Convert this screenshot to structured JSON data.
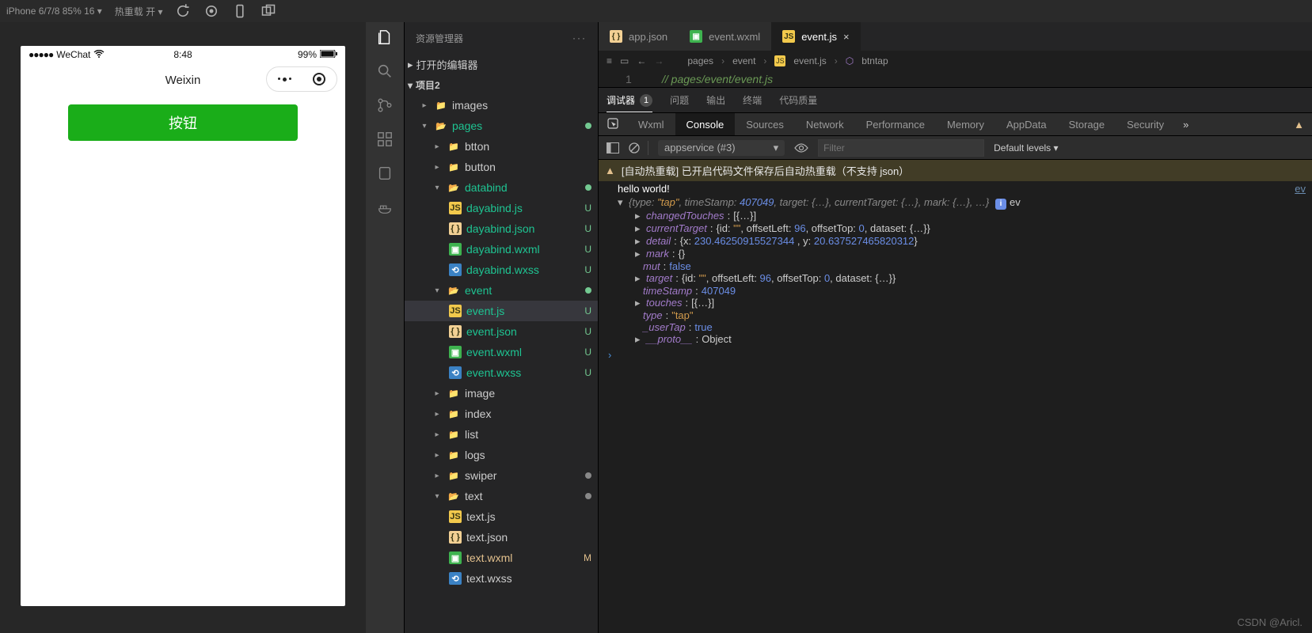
{
  "titlebar": {
    "device": "iPhone 6/7/8 85% 16 ▾",
    "reload_label": "热重载 开 ▾"
  },
  "phone": {
    "carrier": "WeChat",
    "time": "8:48",
    "battery": "99%",
    "nav_title": "Weixin",
    "button_label": "按钮"
  },
  "explorer": {
    "title": "资源管理器",
    "sec_editors": "打开的编辑器",
    "project": "项目2",
    "nodes": {
      "images": "images",
      "pages": "pages",
      "btton": "btton",
      "button": "button",
      "databind": "databind",
      "dayabind_js": "dayabind.js",
      "dayabind_json": "dayabind.json",
      "dayabind_wxml": "dayabind.wxml",
      "dayabind_wxss": "dayabind.wxss",
      "event": "event",
      "event_js": "event.js",
      "event_json": "event.json",
      "event_wxml": "event.wxml",
      "event_wxss": "event.wxss",
      "image": "image",
      "index": "index",
      "list": "list",
      "logs": "logs",
      "swiper": "swiper",
      "text": "text",
      "text_js": "text.js",
      "text_json": "text.json",
      "text_wxml": "text.wxml",
      "text_wxss": "text.wxss"
    }
  },
  "tabs": {
    "t0": "app.json",
    "t1": "event.wxml",
    "t2": "event.js"
  },
  "breadcrumb": {
    "p0": "pages",
    "p1": "event",
    "p2": "event.js",
    "p3": "btntap"
  },
  "code": {
    "lineno": "1",
    "line1": "// pages/event/event.js"
  },
  "dbg_tabs": {
    "debugger": "调试器",
    "debugger_count": "1",
    "problems": "问题",
    "output": "输出",
    "terminal": "终端",
    "quality": "代码质量"
  },
  "dev_tabs": {
    "wxml": "Wxml",
    "console": "Console",
    "sources": "Sources",
    "network": "Network",
    "performance": "Performance",
    "memory": "Memory",
    "appdata": "AppData",
    "storage": "Storage",
    "security": "Security"
  },
  "console": {
    "context": "appservice (#3)",
    "filter_ph": "Filter",
    "levels": "Default levels ▾",
    "warn": "[自动热重载] 已开启代码文件保存后自动热重载（不支持 json）",
    "hello": "hello world!",
    "link_ev": "ev",
    "obj_summary_pre": "{type: ",
    "obj_summary_type": "\"tap\"",
    "obj_summary_mid1": ", timeStamp: ",
    "obj_summary_ts": "407049",
    "obj_summary_mid2": ", target: {…}, currentTarget: {…}, mark: {…}, …}",
    "changedTouches_k": "changedTouches",
    "changedTouches_v": "[{…}]",
    "currentTarget_k": "currentTarget",
    "currentTarget_v1": "{id: ",
    "empty_str": "\"\"",
    "ct_off_l": ", offsetLeft: ",
    "num96": "96",
    "ct_off_t": ", offsetTop: ",
    "num0": "0",
    "ct_ds": ", dataset: {…}}",
    "detail_k": "detail",
    "detail_v1": "{x: ",
    "detail_x": "230.46250915527344 ",
    "detail_v2": ", y: ",
    "detail_y": "20.637527465820312",
    "detail_v3": "}",
    "mark_k": "mark",
    "mark_v": "{}",
    "mut_k": "mut",
    "mut_v": "false",
    "target_k": "target",
    "timeStamp_k": "timeStamp",
    "timeStamp_v": "407049",
    "touches_k": "touches",
    "touches_v": "[{…}]",
    "type_k": "type",
    "type_v": "\"tap\"",
    "usertap_k": "_userTap",
    "usertap_v": "true",
    "proto_k": "__proto__",
    "proto_v": "Object"
  },
  "watermark": "CSDN @Aricl."
}
